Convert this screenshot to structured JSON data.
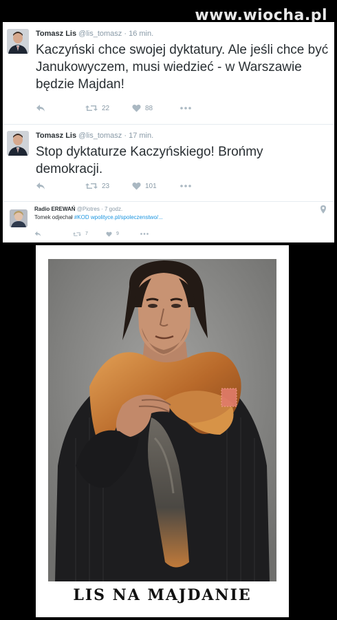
{
  "watermark": "www.wiocha.pl",
  "tweets": [
    {
      "name": "Tomasz Lis",
      "handle": "@lis_tomasz",
      "dot": "·",
      "time": "16 min.",
      "text": "Kaczyński chce swojej dyktatury. Ale jeśli chce być Janukowyczem, musi wiedzieć - w Warszawie będzie Majdan!",
      "retweets": "22",
      "likes": "88"
    },
    {
      "name": "Tomasz Lis",
      "handle": "@lis_tomasz",
      "dot": "·",
      "time": "17 min.",
      "text": "Stop dyktaturze Kaczyńskiego! Brońmy demokracji.",
      "retweets": "23",
      "likes": "101"
    },
    {
      "name": "Radio EREWAŃ",
      "handle": "@Piotres",
      "dot": "·",
      "time": "7 godz.",
      "text_prefix": "Tomek odjechał ",
      "hashtag": "#KOD",
      "link": "wpolityce.pl/spoleczenstwo/...",
      "retweets": "7",
      "likes": "9"
    }
  ],
  "poster": {
    "caption": "LIS NA MAJDANIE"
  },
  "colors": {
    "background": "#000000",
    "tweet_text": "#292f33",
    "muted": "#8899a6",
    "link": "#1b95e0"
  }
}
